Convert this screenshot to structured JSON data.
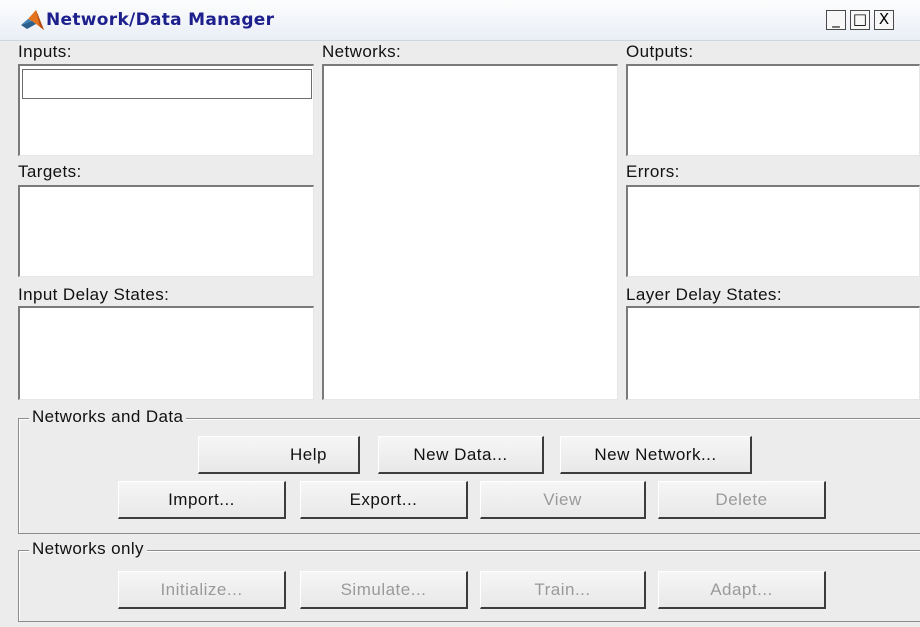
{
  "window": {
    "title": "Network/Data Manager",
    "controls": {
      "minimize": "_",
      "maximize": "□",
      "close": "X"
    }
  },
  "icons": {
    "app": "matlab-logo-icon"
  },
  "panels": {
    "inputs": "Inputs:",
    "targets": "Targets:",
    "input_delay_states": "Input Delay States:",
    "networks": "Networks:",
    "outputs": "Outputs:",
    "errors": "Errors:",
    "layer_delay_states": "Layer Delay States:"
  },
  "networks_and_data": {
    "title": "Networks and Data",
    "help": "Help",
    "new_data": "New Data...",
    "new_network": "New Network...",
    "import": "Import...",
    "export": "Export...",
    "view": "View",
    "delete": "Delete"
  },
  "networks_only": {
    "title": "Networks only",
    "initialize": "Initialize...",
    "simulate": "Simulate...",
    "train": "Train...",
    "adapt": "Adapt..."
  },
  "colors": {
    "title_text": "#1c1f8c",
    "window_bg": "#ececec",
    "disabled_text": "#9a9a9a"
  }
}
